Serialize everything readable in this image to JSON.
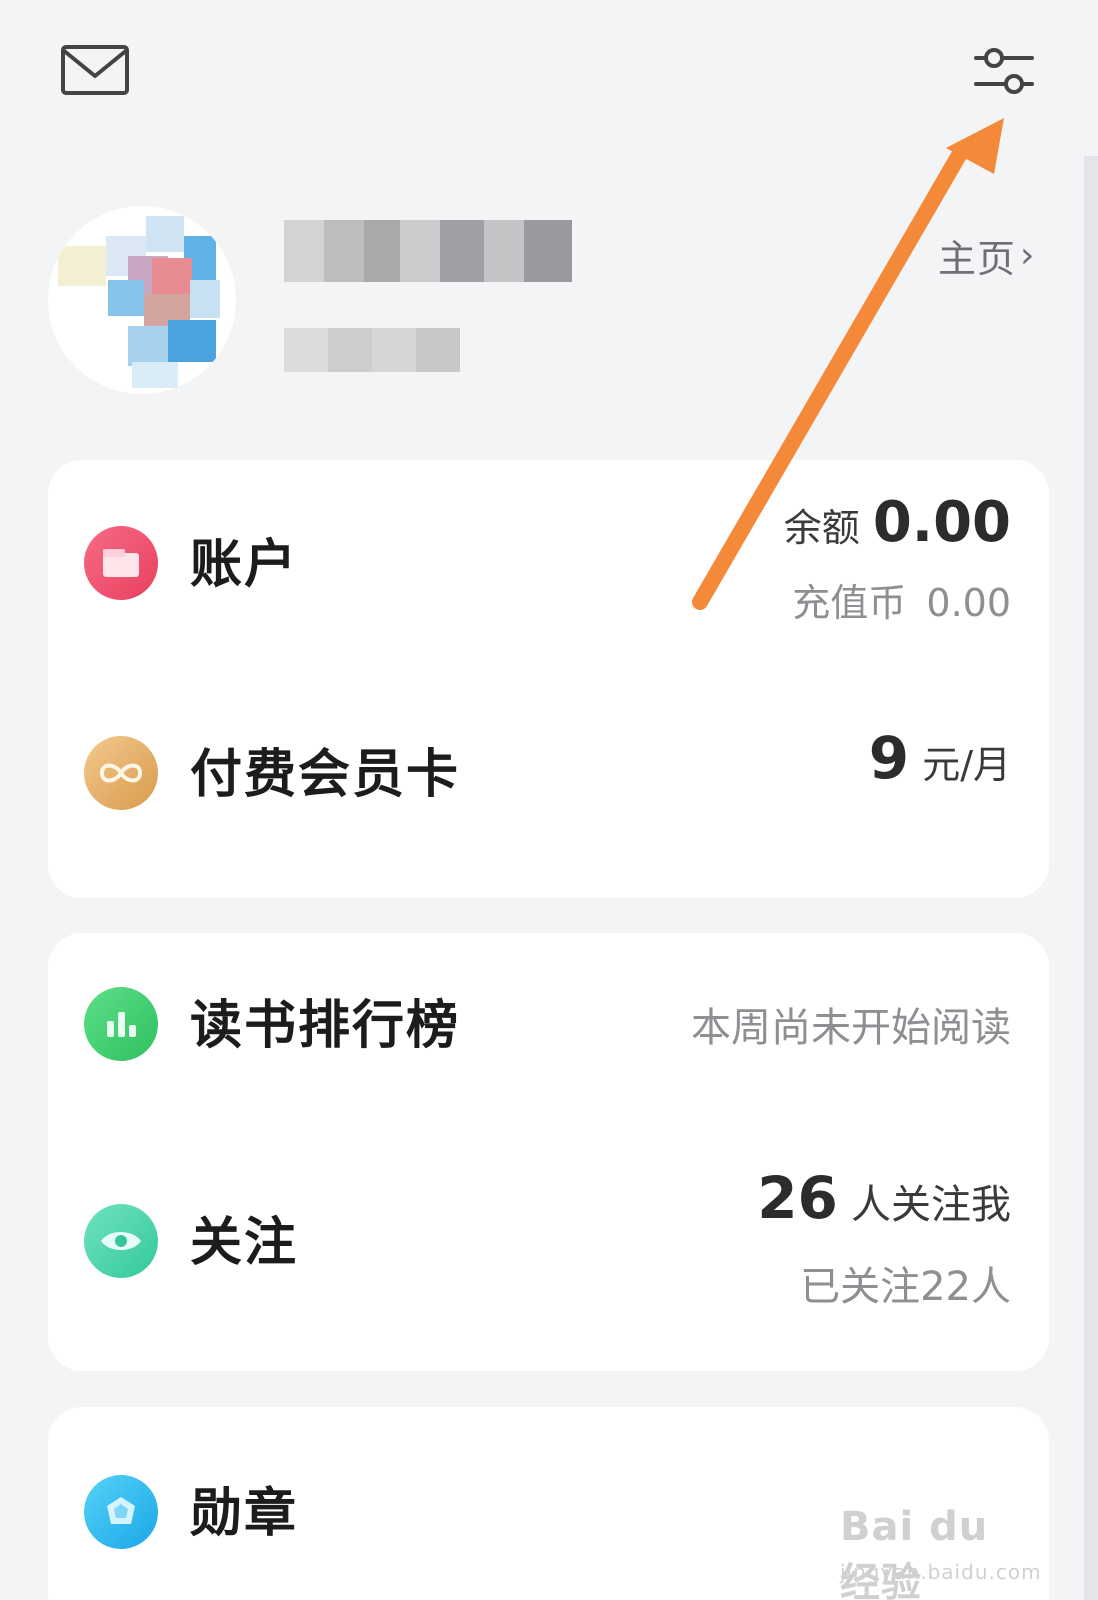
{
  "header": {
    "mail_icon": "mail-icon",
    "settings_icon": "sliders-icon"
  },
  "profile": {
    "homepage_label": "主页",
    "homepage_chevron": "›"
  },
  "card_account": {
    "account": {
      "icon": "wallet-icon",
      "icon_color": "#ef4f6c",
      "title": "账户",
      "balance_label": "余额",
      "balance_value": "0.00",
      "coins_label": "充值币",
      "coins_value": "0.00"
    },
    "membership": {
      "icon": "infinity-icon",
      "icon_color": "#e8b16b",
      "title": "付费会员卡",
      "price": "9",
      "unit": "元/月"
    }
  },
  "card_social": {
    "ranking": {
      "icon": "bar-chart-icon",
      "icon_color": "#3ecf6e",
      "title": "读书排行榜",
      "status": "本周尚未开始阅读"
    },
    "follow": {
      "icon": "eye-icon",
      "icon_color": "#3fd1a6",
      "title": "关注",
      "followers_count": "26",
      "followers_label": "人关注我",
      "following_text": "已关注22人"
    }
  },
  "card_badges": {
    "badges": {
      "icon": "badge-icon",
      "icon_color": "#2ab8ee",
      "title": "勋章"
    }
  },
  "watermark": {
    "brand": "Bai du 经验",
    "url": "jingyan.baidu.com"
  },
  "annotation": {
    "arrow_color": "#f5893a"
  }
}
